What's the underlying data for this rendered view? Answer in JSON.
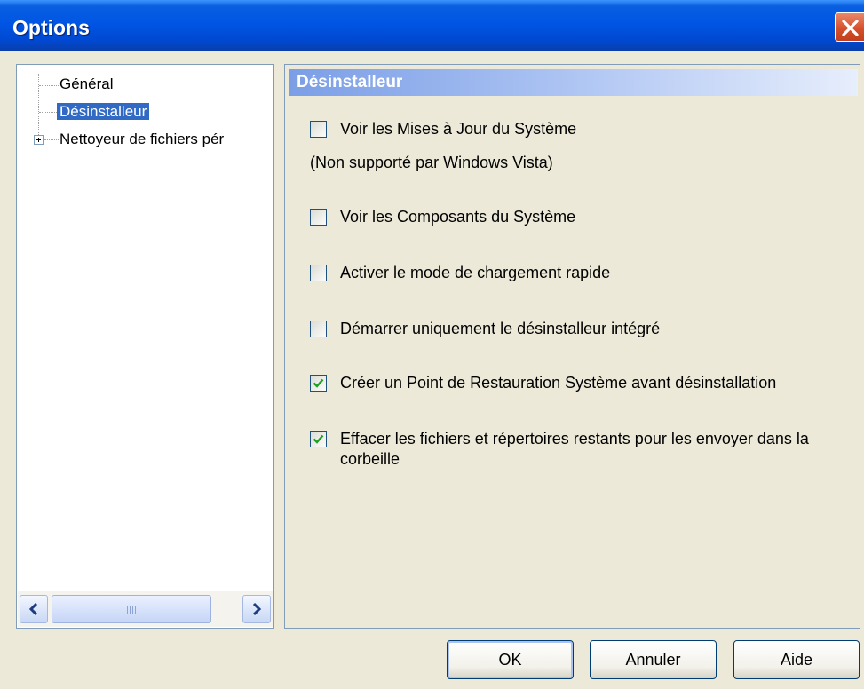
{
  "window": {
    "title": "Options"
  },
  "tree": {
    "items": [
      {
        "label": "Général"
      },
      {
        "label": "Désinstalleur"
      },
      {
        "label": "Nettoyeur de fichiers pér"
      }
    ]
  },
  "panel": {
    "header": "Désinstalleur",
    "options": [
      {
        "label": "Voir les Mises à Jour du Système",
        "checked": false
      },
      {
        "label": "Voir les Composants du Système",
        "checked": false
      },
      {
        "label": "Activer le mode de chargement rapide",
        "checked": false
      },
      {
        "label": "Démarrer uniquement le désinstalleur intégré",
        "checked": false
      },
      {
        "label": "Créer un Point de Restauration Système avant désinstallation",
        "checked": true
      },
      {
        "label": "Effacer les fichiers et répertoires restants pour les envoyer dans la corbeille",
        "checked": true
      }
    ],
    "note": "(Non supporté par Windows Vista)"
  },
  "buttons": {
    "ok": "OK",
    "cancel": "Annuler",
    "help": "Aide"
  },
  "colors": {
    "titlebar": "#0055e5",
    "selection": "#316ac5",
    "check": "#21a121"
  }
}
